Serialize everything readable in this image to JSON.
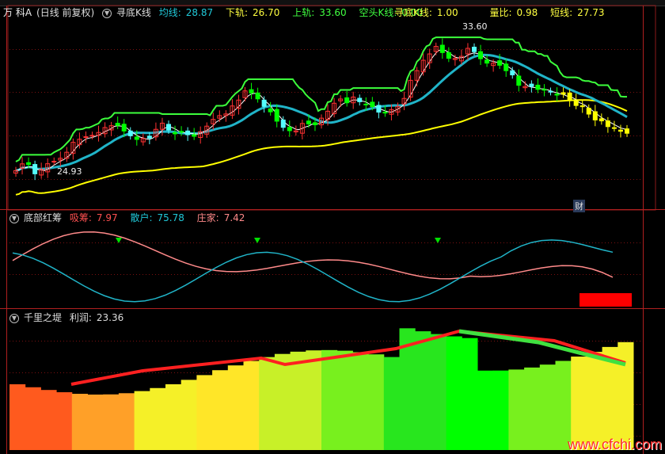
{
  "panel1": {
    "stock": "万 科A",
    "mode": "(日线 前复权)",
    "indicator_name": "寻底K线",
    "avg_label": "均线:",
    "avg_value": "28.87",
    "lower_label": "下轨:",
    "lower_value": "26.70",
    "upper_label": "上轨:",
    "upper_value": "33.60",
    "trend_label": "空头K线:",
    "trend_value": "0.00",
    "seek_label": "寻底K线:",
    "seek_value": "1.00",
    "ratio_label": "量比:",
    "ratio_value": "0.98",
    "short_label": "短线:",
    "short_value": "27.73",
    "max_label": "33.60",
    "min_label": "24.93",
    "badge": "财"
  },
  "panel2": {
    "name": "底部红筹",
    "absorb_label": "吸筹:",
    "absorb_value": "7.97",
    "retail_label": "散户:",
    "retail_value": "75.78",
    "dealer_label": "庄家:",
    "dealer_value": "7.42"
  },
  "panel3": {
    "name": "千里之堤",
    "profit_label": "利润:",
    "profit_value": "23.36"
  },
  "watermark": "www.cfchi.com",
  "colors": {
    "up": "#ff3232",
    "down": "#00ff00",
    "doji": "#54fcfc",
    "yellow": "#ffff00",
    "cyan": "#20b4c8",
    "green": "#3cff3c",
    "pink": "#ff8a8a",
    "white": "#ffffff"
  },
  "chart_data": [
    {
      "type": "candlestick",
      "panel": "main",
      "ylim": [
        22.8,
        35.2
      ],
      "x": [
        0,
        1,
        2,
        3,
        4,
        5,
        6,
        7,
        8,
        9,
        10,
        11,
        12,
        13,
        14,
        15,
        16,
        17,
        18,
        19,
        20,
        21,
        22,
        23,
        24,
        25,
        26,
        27,
        28,
        29,
        30,
        31,
        32,
        33,
        34,
        35,
        36,
        37,
        38,
        39,
        40,
        41,
        42,
        43,
        44,
        45,
        46,
        47,
        48,
        49,
        50,
        51,
        52,
        53,
        54,
        55,
        56,
        57,
        58,
        59,
        60,
        61,
        62,
        63,
        64,
        65,
        66,
        67,
        68,
        69,
        70,
        71,
        72,
        73,
        74,
        75,
        76,
        77,
        78,
        79,
        80,
        81,
        82,
        83,
        84,
        85,
        86,
        87,
        88,
        89,
        90,
        91,
        92,
        93,
        94,
        95,
        96,
        97,
        98,
        99,
        100,
        101,
        102,
        103,
        104,
        105,
        106,
        107,
        108,
        109,
        110,
        111,
        112,
        113,
        114,
        115,
        116,
        117,
        118,
        119,
        120,
        121,
        122,
        123,
        124,
        125,
        126,
        127,
        128,
        129,
        130,
        131,
        132,
        133,
        134,
        135,
        136,
        137,
        138,
        139,
        140,
        141,
        142,
        143,
        144,
        145,
        146,
        147,
        148,
        149,
        150,
        151,
        152,
        153,
        154,
        155,
        156,
        157,
        158,
        159,
        160,
        161,
        162,
        163,
        164,
        165,
        166,
        167,
        168,
        169,
        170,
        171,
        172,
        173,
        174,
        175,
        176,
        177,
        178,
        179,
        180,
        181,
        182,
        183,
        184,
        185,
        186,
        187,
        188,
        189,
        190,
        191,
        192,
        193,
        194
      ],
      "close": [
        25.25,
        25.36,
        25.7,
        25.47,
        25.66,
        25.33,
        25.04,
        25.12,
        25.33,
        25.46,
        25.71,
        25.71,
        25.87,
        25.97,
        26.07,
        26.25,
        26.47,
        26.7,
        27.13,
        27.38,
        27.33,
        27.41,
        27.5,
        27.43,
        27.59,
        27.69,
        27.78,
        28.05,
        28.11,
        28.05,
        28.23,
        28.48,
        28.25,
        28.02,
        27.88,
        27.67,
        27.56,
        27.53,
        27.32,
        27.29,
        27.38,
        27.22,
        27.41,
        27.74,
        27.99,
        28.15,
        28.4,
        28.21,
        27.94,
        27.88,
        27.69,
        27.74,
        27.8,
        27.69,
        27.63,
        27.78,
        27.53,
        27.76,
        27.83,
        28.26,
        28.2,
        28.32,
        28.65,
        28.95,
        28.9,
        28.9,
        29.01,
        29.27,
        29.54,
        29.76,
        29.93,
        30.1,
        30.54,
        30.71,
        30.4,
        30.15,
        30.01,
        29.72,
        29.51,
        29.33,
        29.15,
        28.61,
        28.53,
        28.45,
        28.12,
        27.98,
        27.9,
        28.07,
        27.89,
        28.03,
        28.38,
        28.37,
        28.35,
        28.47,
        28.29,
        28.31,
        28.73,
        28.7,
        29.19,
        29.25,
        29.72,
        29.65,
        30.0,
        29.93,
        29.75,
        29.9,
        30.13,
        29.93,
        29.82,
        29.51,
        29.63,
        29.46,
        29.5,
        29.42,
        29.13,
        28.97,
        29.07,
        29.17,
        29.3,
        29.61,
        29.51,
        29.74,
        30.04,
        30.79,
        31.24,
        31.36,
        31.88,
        32.08,
        32.57,
        32.9,
        32.99,
        33.39,
        33.49,
        33.39,
        33.08,
        32.75,
        32.7,
        32.67,
        32.69,
        32.81,
        32.83,
        32.89,
        33.36,
        33.1,
        33.14,
        32.58,
        32.67,
        32.49,
        32.38,
        32.56,
        32.38,
        32.39,
        32.24,
        32.26,
        31.88,
        31.73,
        31.6,
        31.17,
        30.91,
        30.7,
        30.83,
        30.64,
        30.84,
        30.78,
        30.64,
        30.5,
        30.59,
        30.52,
        30.49,
        30.23,
        30.26,
        30.21,
        30.32,
        30.01,
        29.9,
        29.98,
        29.57,
        29.38,
        29.55,
        29.35,
        29.0,
        28.97,
        28.61,
        28.69,
        28.55,
        28.47,
        28.17,
        28.23,
        28.1,
        28.02,
        27.86,
        27.94,
        27.73
      ],
      "open_high_low": "derived from close with small offsets in script",
      "series": [
        {
          "name": "均线",
          "values_ref": "ma"
        },
        {
          "name": "下轨",
          "values_ref": "lower"
        },
        {
          "name": "上轨",
          "values_ref": "upper"
        }
      ]
    },
    {
      "type": "line",
      "panel": "indicator",
      "series": [
        {
          "name": "吸筹",
          "values": [
            7.97
          ]
        },
        {
          "name": "散户",
          "values": [
            75.78
          ]
        },
        {
          "name": "庄家",
          "values": [
            7.42
          ]
        }
      ]
    },
    {
      "type": "area",
      "panel": "profit",
      "series": [
        {
          "name": "利润",
          "values": [
            23.36
          ]
        }
      ]
    }
  ]
}
